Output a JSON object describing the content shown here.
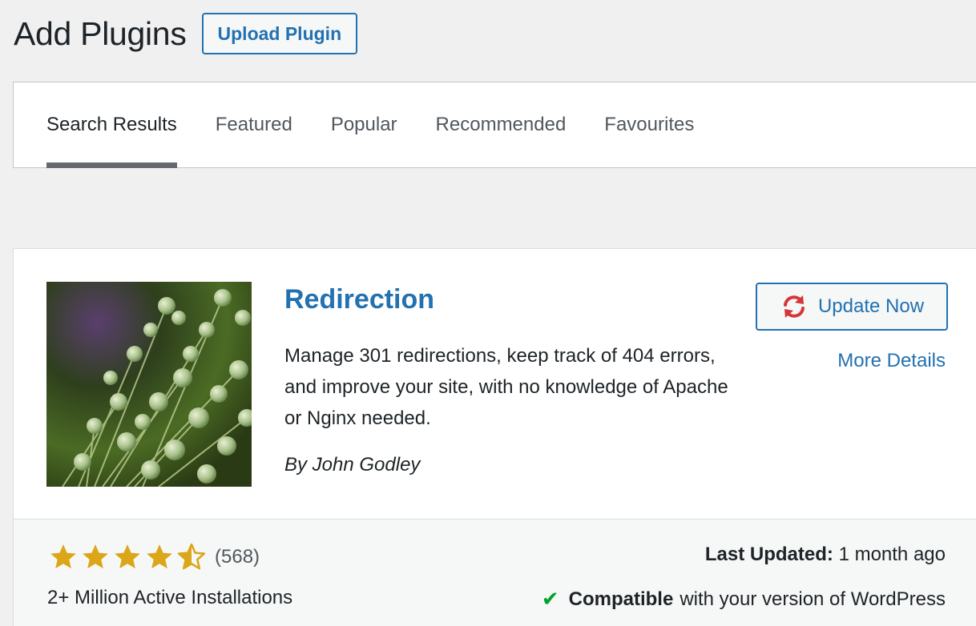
{
  "header": {
    "title": "Add Plugins",
    "upload_label": "Upload Plugin"
  },
  "tabs": [
    {
      "label": "Search Results",
      "active": true
    },
    {
      "label": "Featured",
      "active": false
    },
    {
      "label": "Popular",
      "active": false
    },
    {
      "label": "Recommended",
      "active": false
    },
    {
      "label": "Favourites",
      "active": false
    }
  ],
  "plugin": {
    "name": "Redirection",
    "description": "Manage 301 redirections, keep track of 404 errors, and improve your site, with no knowledge of Apache or Nginx needed.",
    "author": "By John Godley",
    "update_label": "Update Now",
    "update_icon": "refresh-icon",
    "more_details_label": "More Details",
    "rating_stars": 4.5,
    "rating_max": 5,
    "rating_count": "(568)",
    "installs": "2+ Million Active Installations",
    "last_updated_label": "Last Updated:",
    "last_updated_value": "1 month ago",
    "compat_strong": "Compatible",
    "compat_text": "with your version of WordPress"
  },
  "colors": {
    "accent": "#2271b1",
    "star": "#dba617",
    "refresh": "#d63638",
    "check": "#00a32a"
  }
}
